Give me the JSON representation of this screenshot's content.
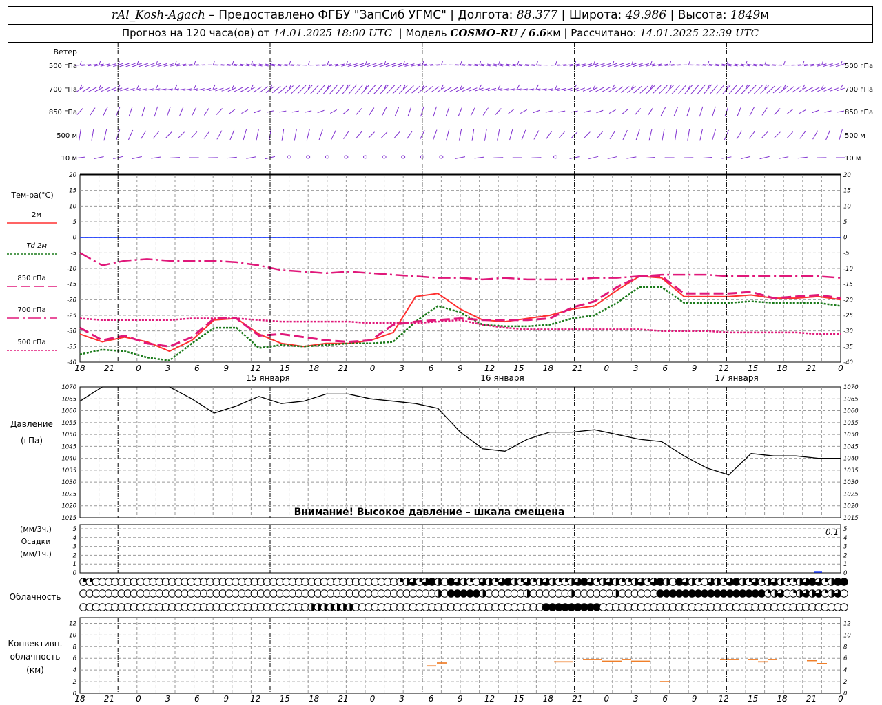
{
  "header": {
    "station": "rAl_Kosh-Agach",
    "provider": "– Предоставлено ФГБУ \"ЗапСиб УГМС\"",
    "lon_label": "Долгота:",
    "lon_value": "88.377",
    "lat_label": "Широта:",
    "lat_value": "49.986",
    "alt_label": "Высота:",
    "alt_value": "1849",
    "alt_unit": "м",
    "forecast_prefix": "Прогноз на 120 часа(ов) от",
    "forecast_start": "14.01.2025 18:00 UTC",
    "model_label": "Модель",
    "model_name": "COSMO-RU / 6.6",
    "model_unit": "км",
    "calc_label": "Рассчитано:",
    "calc_time": "14.01.2025 22:39 UTC"
  },
  "wind_panel": {
    "title": "Ветер",
    "levels": [
      "500 гПа",
      "700 гПа",
      "850 гПа",
      "500 м",
      "10 м"
    ],
    "color": "#7f2fd0"
  },
  "temp_panel": {
    "title": "Тем-ра(°С)",
    "legend": [
      {
        "label": "2м",
        "color": "#ff3030"
      },
      {
        "label": "Td 2м",
        "color": "#1a7a1a"
      },
      {
        "label": "850 гПа",
        "color": "#e0187a"
      },
      {
        "label": "700 гПа",
        "color": "#e0187a"
      },
      {
        "label": "500 гПа",
        "color": "#e0187a"
      }
    ],
    "y_ticks": [
      "20",
      "15",
      "10",
      "5",
      "0",
      "-5",
      "-10",
      "-15",
      "-20",
      "-25",
      "-30",
      "-35",
      "-40"
    ],
    "x_tick_labels": [
      "18",
      "21",
      "0",
      "3",
      "6",
      "9",
      "12",
      "15",
      "18",
      "21",
      "0",
      "3",
      "6",
      "9",
      "12",
      "15",
      "18",
      "21",
      "0",
      "3",
      "6",
      "9",
      "12",
      "15",
      "18",
      "21",
      "0"
    ],
    "date_labels": [
      "15 января",
      "16 января",
      "17 января"
    ]
  },
  "pressure_panel": {
    "title": "Давление",
    "unit": "(гПа)",
    "y_ticks": [
      "1070",
      "1065",
      "1060",
      "1055",
      "1050",
      "1045",
      "1040",
      "1035",
      "1030",
      "1025",
      "1020",
      "1015"
    ],
    "warning": "Внимание! Высокое давление – шкала смещена"
  },
  "precip_panel": {
    "unit_3h": "(мм/3ч.)",
    "title": "Осадки",
    "unit_1h": "(мм/1ч.)",
    "y_ticks": [
      "5",
      "4",
      "3",
      "2",
      "1",
      "0"
    ],
    "max_label": "0.1"
  },
  "cloud_panel": {
    "title": "Облачность"
  },
  "conv_panel": {
    "title1": "Конвективн.",
    "title2": "облачность",
    "unit": "(км)",
    "y_ticks": [
      "12",
      "10",
      "8",
      "6",
      "4",
      "2",
      "0"
    ],
    "color": "#f07f2a"
  },
  "chart_data": {
    "type": "line",
    "x_hours": [
      0,
      3,
      6,
      9,
      12,
      15,
      18,
      21,
      24,
      27,
      30,
      33,
      36,
      39,
      42,
      45,
      48,
      51,
      54,
      57,
      60,
      63,
      66,
      69,
      72,
      75,
      78,
      81,
      84,
      87,
      90,
      93,
      96,
      99,
      102,
      105,
      108,
      111,
      114,
      117,
      120
    ],
    "series": [
      {
        "name": "2м",
        "color": "#ff3030",
        "values": [
          -31,
          -33.5,
          -32,
          -33.5,
          -36.5,
          -33,
          -26.5,
          -26,
          -31,
          -34,
          -35,
          -34,
          -34,
          -33,
          -30.5,
          -19,
          -18,
          -23,
          -26.5,
          -27,
          -26,
          -25,
          -23,
          -22,
          -17,
          -12.5,
          -13,
          -19,
          -19,
          -19,
          -18.5,
          -19.5,
          -19.5,
          -19,
          -20
        ]
      },
      {
        "name": "Td 2м",
        "color": "#1a7a1a",
        "values": [
          -37.5,
          -36,
          -36.5,
          -38.5,
          -39.5,
          -34,
          -29,
          -29,
          -35.5,
          -34.5,
          -35,
          -34.5,
          -34,
          -34,
          -33.5,
          -27,
          -22,
          -24,
          -28,
          -28.5,
          -28.5,
          -28,
          -26,
          -25,
          -21,
          -16,
          -16,
          -21,
          -21,
          -21,
          -20.5,
          -21,
          -21,
          -21,
          -22
        ]
      },
      {
        "name": "850 гПа",
        "color": "#e0187a",
        "values": [
          -29,
          -33,
          -31.5,
          -34,
          -35,
          -32,
          -26,
          -26,
          -31.5,
          -31,
          -32,
          -33,
          -33.5,
          -33,
          -28,
          -27,
          -26.5,
          -26,
          -26.5,
          -26.5,
          -26.5,
          -26,
          -22.5,
          -20.5,
          -16,
          -12.5,
          -12.5,
          -18,
          -18,
          -18,
          -17.5,
          -19.5,
          -19,
          -18.5,
          -19.5
        ]
      },
      {
        "name": "700 гПа",
        "color": "#e0187a",
        "values": [
          -5,
          -9,
          -7.5,
          -7,
          -7.5,
          -7.5,
          -7.5,
          -8,
          -9,
          -10.5,
          -11,
          -11.5,
          -11,
          -11.5,
          -12,
          -12.5,
          -13,
          -13,
          -13.5,
          -13,
          -13.5,
          -13.5,
          -13.5,
          -13,
          -13,
          -12.5,
          -12,
          -12,
          -12,
          -12.5,
          -12.5,
          -12.5,
          -12.5,
          -12.5,
          -13
        ]
      },
      {
        "name": "500 гПа",
        "color": "#e0187a",
        "values": [
          -26,
          -26.5,
          -26.5,
          -26.5,
          -26.5,
          -26,
          -26,
          -26,
          -26.5,
          -27,
          -27,
          -27,
          -27,
          -27.5,
          -27.5,
          -27.5,
          -27,
          -26.5,
          -28,
          -29,
          -29.5,
          -29.5,
          -29.5,
          -29.5,
          -29.5,
          -29.5,
          -30,
          -30,
          -30,
          -30.5,
          -30.5,
          -30.5,
          -30.5,
          -31,
          -31
        ]
      },
      {
        "name": "Давление",
        "color": "#000000",
        "values": [
          1064,
          1071,
          1075,
          1076,
          1072,
          1065,
          1059,
          1062,
          1066,
          1063,
          1064,
          1067,
          1067,
          1065,
          1064,
          1063,
          1061,
          1051,
          1044,
          1043,
          1048,
          1051,
          1051,
          1052,
          1050,
          1048,
          1047,
          1041,
          1036,
          1033,
          1042,
          1041,
          1041,
          1040,
          1040
        ]
      }
    ],
    "ylabel_temp": "Тем-ра(°С)",
    "ylim_temp": [
      -40,
      20
    ],
    "ylabel_pressure": "Давление",
    "ylim_pressure": [
      1015,
      1070
    ],
    "ylim_precip": [
      0,
      5
    ],
    "ylim_conv": [
      0,
      13
    ],
    "convective_cloud_km": [
      {
        "hour": 60,
        "base": 4.6,
        "top": 4.9
      },
      {
        "hour": 63,
        "base": 5.0,
        "top": 5.3
      },
      {
        "hour": 96,
        "base": 5.3,
        "top": 5.6
      },
      {
        "hour": 102,
        "base": 5.6,
        "top": 5.9
      },
      {
        "hour": 105,
        "base": 5.4,
        "top": 5.7
      },
      {
        "hour": 108,
        "base": 5.2,
        "top": 5.6
      },
      {
        "hour": 111,
        "base": 5.3,
        "top": 5.6
      },
      {
        "hour": 114,
        "base": 2.0,
        "top": 2.1
      },
      {
        "hour": 117,
        "base": 5.6,
        "top": 5.9
      },
      {
        "hour": 120,
        "base": 5.5,
        "top": 5.8
      }
    ],
    "grid": true
  }
}
